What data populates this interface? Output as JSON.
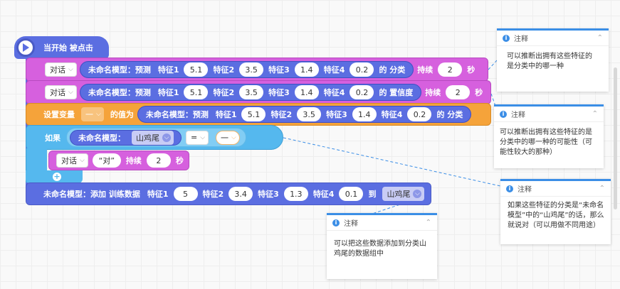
{
  "hat": {
    "label": "当开始 被点击"
  },
  "row1": {
    "action": "对话",
    "model": "未命名模型：预测",
    "f1_label": "特征1",
    "f1": "5.1",
    "f2_label": "特征2",
    "f2": "3.5",
    "f3_label": "特征3",
    "f3": "1.4",
    "f4_label": "特征4",
    "f4": "0.2",
    "tail": "的 分类",
    "duration_label": "持续",
    "duration": "2",
    "unit": "秒"
  },
  "row2": {
    "action": "对话",
    "model": "未命名模型：预测",
    "f1_label": "特征1",
    "f1": "5.1",
    "f2_label": "特征2",
    "f2": "3.5",
    "f3_label": "特征3",
    "f3": "1.4",
    "f4_label": "特征4",
    "f4": "0.2",
    "tail": "的 置信度",
    "duration_label": "持续",
    "duration": "2",
    "unit": "秒"
  },
  "row3": {
    "label": "设置变量",
    "variable": "一",
    "value_label": "的值为",
    "model": "未命名模型：预测",
    "f1_label": "特征1",
    "f1": "5.1",
    "f2_label": "特征2",
    "f2": "3.5",
    "f3_label": "特征3",
    "f3": "1.4",
    "f4_label": "特征4",
    "f4": "0.2",
    "tail": "的 分类"
  },
  "if_block": {
    "label": "如果",
    "model": "未命名模型：",
    "class": "山鸡尾",
    "operator": "=",
    "variable": "一"
  },
  "say_block": {
    "action": "对话",
    "text": "“对”",
    "duration_label": "持续",
    "duration": "2",
    "unit": "秒"
  },
  "add_row": {
    "model": "未命名模型：添加 训练数据",
    "f1_label": "特征1",
    "f1": "5",
    "f2_label": "特征2",
    "f2": "3.4",
    "f3_label": "特征3",
    "f3": "1.3",
    "f4_label": "特征4",
    "f4": "0.1",
    "to_label": "到",
    "class": "山鸡尾"
  },
  "notes": [
    {
      "title": "注释",
      "body": "可以推断出拥有这些特征的是分类中的哪一种"
    },
    {
      "title": "注释",
      "body": "可以推断出拥有这些特征的是分类中的哪一种的可能性（可能性较大的那种）"
    },
    {
      "title": "注释",
      "body": "如果这些特征的分类是“未命名模型”中的“山鸡尾”的话，那么就说对（可以用做不同用途）"
    },
    {
      "title": "注释",
      "body": "可以把这些数据添加到分类山鸡尾的数据组中"
    }
  ],
  "colors": {
    "purple": "#5b6ee1",
    "pink": "#d660de",
    "orange": "#f5a33a",
    "cyan": "#55b8ee",
    "note_accent": "#3b8ee6"
  }
}
